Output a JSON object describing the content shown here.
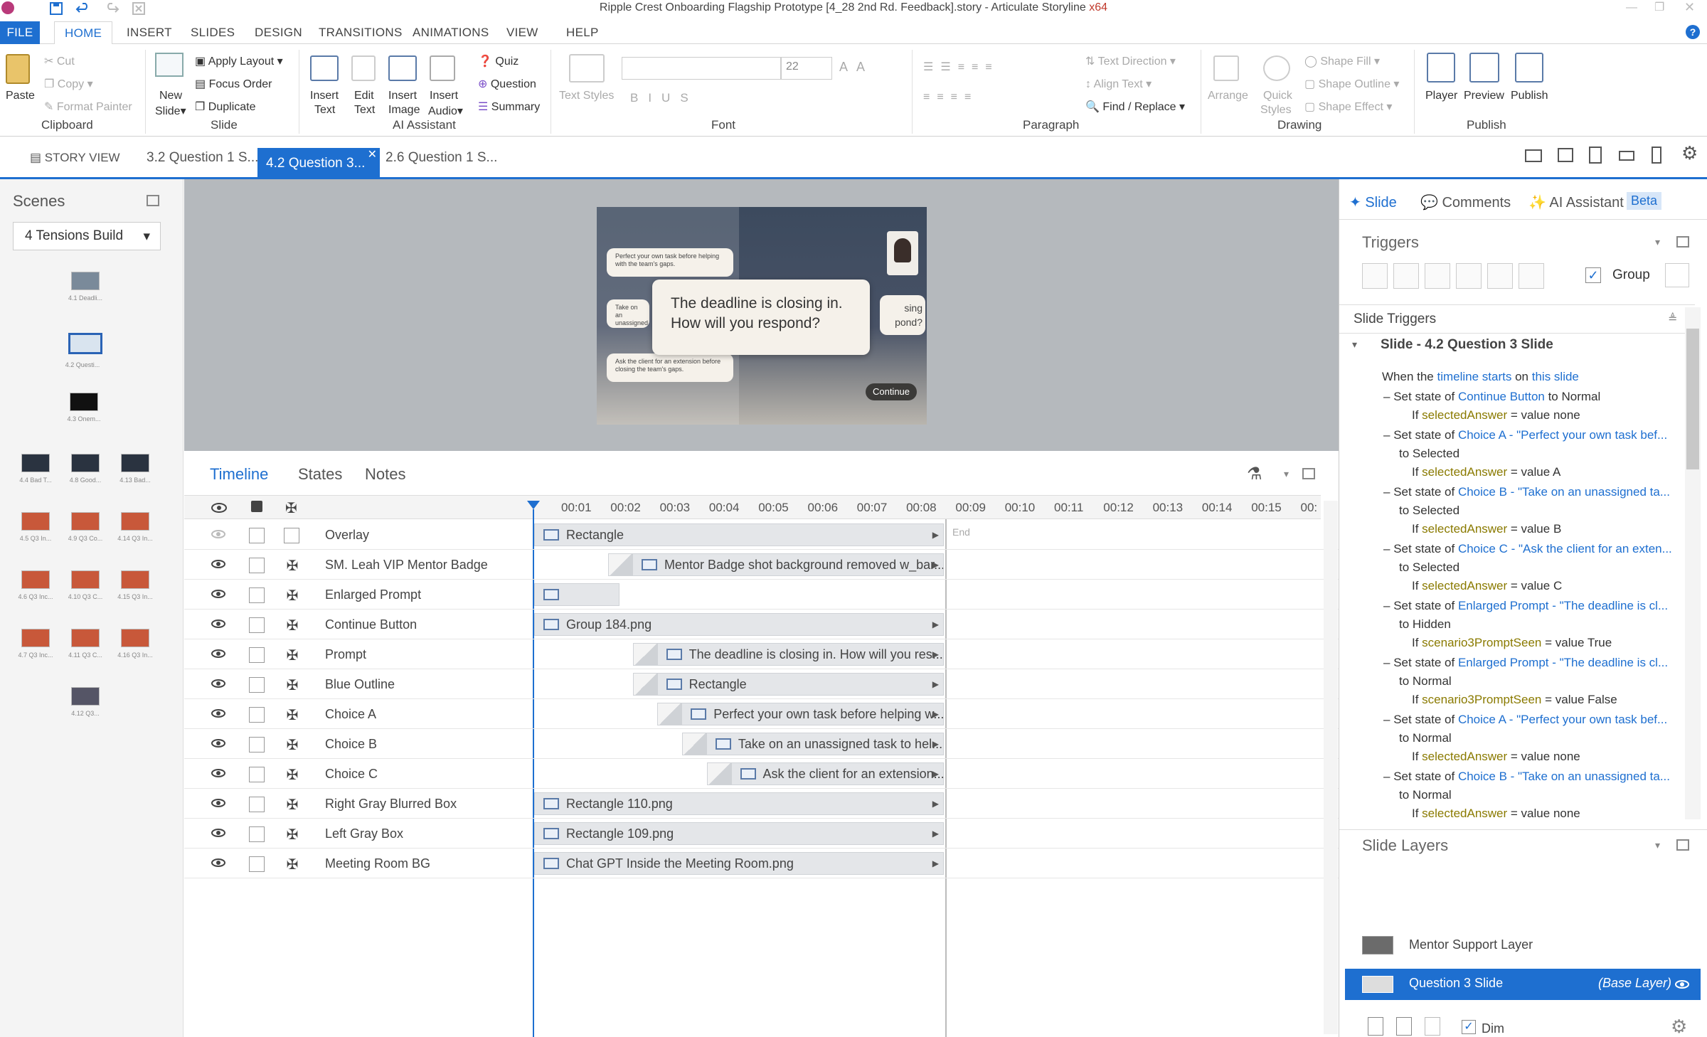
{
  "window": {
    "title": "Ripple Crest Onboarding Flagship Prototype [4_28 2nd Rd. Feedback].story - Articulate Storyline",
    "arch": "x64"
  },
  "ribbon_tabs": [
    "FILE",
    "HOME",
    "INSERT",
    "SLIDES",
    "DESIGN",
    "TRANSITIONS",
    "ANIMATIONS",
    "VIEW",
    "HELP"
  ],
  "ribbon": {
    "clipboard": {
      "paste": "Paste",
      "cut": "Cut",
      "copy": "Copy",
      "format_painter": "Format Painter",
      "label": "Clipboard"
    },
    "slide": {
      "new_slide": "New",
      "new_slide2": "Slide",
      "apply_layout": "Apply Layout",
      "focus_order": "Focus Order",
      "duplicate": "Duplicate",
      "label": "Slide"
    },
    "ai": {
      "insert_text": "Insert",
      "insert_text2": "Text",
      "edit_text": "Edit",
      "edit_text2": "Text",
      "insert_image": "Insert",
      "insert_image2": "Image",
      "insert_audio": "Insert",
      "insert_audio2": "Audio",
      "quiz": "Quiz",
      "question": "Question",
      "summary": "Summary",
      "label": "AI Assistant"
    },
    "font": {
      "text_styles": "Text Styles",
      "size": "22",
      "label": "Font"
    },
    "paragraph": {
      "text_direction": "Text Direction",
      "align_text": "Align Text",
      "find_replace": "Find / Replace",
      "label": "Paragraph"
    },
    "drawing": {
      "arrange": "Arrange",
      "quick_styles": "Quick",
      "quick_styles2": "Styles",
      "shape_fill": "Shape Fill",
      "shape_outline": "Shape Outline",
      "shape_effect": "Shape Effect",
      "label": "Drawing"
    },
    "publish": {
      "player": "Player",
      "preview": "Preview",
      "publish": "Publish",
      "label": "Publish"
    }
  },
  "doc_tabs": {
    "story_view": "STORY VIEW",
    "tabs": [
      "3.2 Question 1 S...",
      "4.2 Question 3...",
      "2.6 Question 1 S..."
    ],
    "active_index": 1
  },
  "scenes": {
    "title": "Scenes",
    "selected": "4 Tensions Build",
    "thumbs": [
      "4.1 Deadli...",
      "4.2 Questi...",
      "4.3 Onem...",
      "4.4 Bad T...",
      "4.8 Good...",
      "4.13 Bad...",
      "4.5 Q3 In...",
      "4.9 Q3 Co...",
      "4.14 Q3 In...",
      "4.6 Q3 Inc...",
      "4.10 Q3 C...",
      "4.15 Q3 In...",
      "4.7 Q3 Inc...",
      "4.11 Q3 C...",
      "4.16 Q3 In...",
      "4.12 Q3..."
    ]
  },
  "slide_preview": {
    "prompt": "The deadline is closing in. How will you respond?",
    "choice_a": "Perfect your own task before helping with the team's gaps.",
    "choice_b": "Take on an unassigned task to help meet...",
    "choice_c": "Ask the client for an extension before closing the team's gaps.",
    "right_partial_1": "sing",
    "right_partial_2": "pond?",
    "continue": "Continue"
  },
  "timeline": {
    "tabs": [
      "Timeline",
      "States",
      "Notes"
    ],
    "ticks": [
      "00:01",
      "00:02",
      "00:03",
      "00:04",
      "00:05",
      "00:06",
      "00:07",
      "00:08",
      "00:09",
      "00:10",
      "00:11",
      "00:12",
      "00:13",
      "00:14",
      "00:15",
      "00:"
    ],
    "end_label": "End",
    "layers": [
      {
        "name": "Overlay",
        "bar": "Rectangle",
        "start": 0
      },
      {
        "name": "SM. Leah VIP Mentor Badge",
        "bar": "Mentor Badge shot background removed w_bar...",
        "start": 1.5
      },
      {
        "name": "Enlarged Prompt",
        "bar": "",
        "start": 0
      },
      {
        "name": "Continue Button",
        "bar": "Group 184.png",
        "start": 0
      },
      {
        "name": "Prompt",
        "bar": "The deadline is closing in. How will you res...",
        "start": 2
      },
      {
        "name": "Blue Outline",
        "bar": "Rectangle",
        "start": 2
      },
      {
        "name": "Choice A",
        "bar": "Perfect your own task before helping w...",
        "start": 2.5
      },
      {
        "name": "Choice B",
        "bar": "Take on an unassigned task to hel...",
        "start": 3
      },
      {
        "name": "Choice C",
        "bar": "Ask the client for an extension...",
        "start": 3.5
      },
      {
        "name": "Right Gray Blurred Box",
        "bar": "Rectangle 110.png",
        "start": 0
      },
      {
        "name": "Left Gray Box",
        "bar": "Rectangle 109.png",
        "start": 0
      },
      {
        "name": "Meeting Room BG",
        "bar": "Chat GPT Inside the Meeting Room.png",
        "start": 0
      }
    ]
  },
  "right_panel": {
    "tabs": [
      "Slide",
      "Comments",
      "AI Assistant"
    ],
    "beta": "Beta",
    "triggers_title": "Triggers",
    "group_label": "Group",
    "slide_triggers_title": "Slide Triggers",
    "slide_node": "Slide - 4.2 Question 3 Slide",
    "when": {
      "pre": "When the ",
      "event": "timeline starts",
      "mid": " on ",
      "obj": "this slide"
    },
    "actions": [
      {
        "l1": [
          "Set state of ",
          "Continue Button",
          " to ",
          "Normal"
        ],
        "l2": null,
        "cond": [
          "selectedAnswer",
          " = value ",
          "none"
        ]
      },
      {
        "l1": [
          "Set state of ",
          "Choice A - \"Perfect your own task bef...",
          "",
          " "
        ],
        "l2": "Selected",
        "cond": [
          "selectedAnswer",
          " = value ",
          "A"
        ]
      },
      {
        "l1": [
          "Set state of ",
          "Choice B - \"Take on an unassigned ta...",
          "",
          " "
        ],
        "l2": "Selected",
        "cond": [
          "selectedAnswer",
          " = value ",
          "B"
        ]
      },
      {
        "l1": [
          "Set state of ",
          "Choice C - \"Ask the client for an exten...",
          "",
          " "
        ],
        "l2": "Selected",
        "cond": [
          "selectedAnswer",
          " = value ",
          "C"
        ]
      },
      {
        "l1": [
          "Set state of ",
          "Enlarged Prompt - \"The deadline is cl...",
          "",
          " "
        ],
        "l2": "Hidden",
        "cond": [
          "scenario3PromptSeen",
          " = value ",
          "True"
        ]
      },
      {
        "l1": [
          "Set state of ",
          "Enlarged Prompt - \"The deadline is cl...",
          "",
          " "
        ],
        "l2": "Normal",
        "cond": [
          "scenario3PromptSeen",
          " = value ",
          "False"
        ]
      },
      {
        "l1": [
          "Set state of ",
          "Choice A - \"Perfect your own task bef...",
          "",
          " "
        ],
        "l2": "Normal",
        "cond": [
          "selectedAnswer",
          " = value ",
          "none"
        ]
      },
      {
        "l1": [
          "Set state of ",
          "Choice B - \"Take on an unassigned ta...",
          "",
          " "
        ],
        "l2": "Normal",
        "cond": [
          "selectedAnswer",
          " = value ",
          "none"
        ]
      }
    ],
    "to_word": "to ",
    "if_word": "If ",
    "layers_title": "Slide Layers",
    "layers": [
      {
        "name": "Mentor Support Layer",
        "tag": ""
      },
      {
        "name": "Question 3 Slide",
        "tag": "(Base Layer)"
      }
    ],
    "dim": "Dim"
  },
  "colors": {
    "accent": "#1e6fd0",
    "olive": "#8a7a00",
    "stage": "#b5b9bd"
  }
}
